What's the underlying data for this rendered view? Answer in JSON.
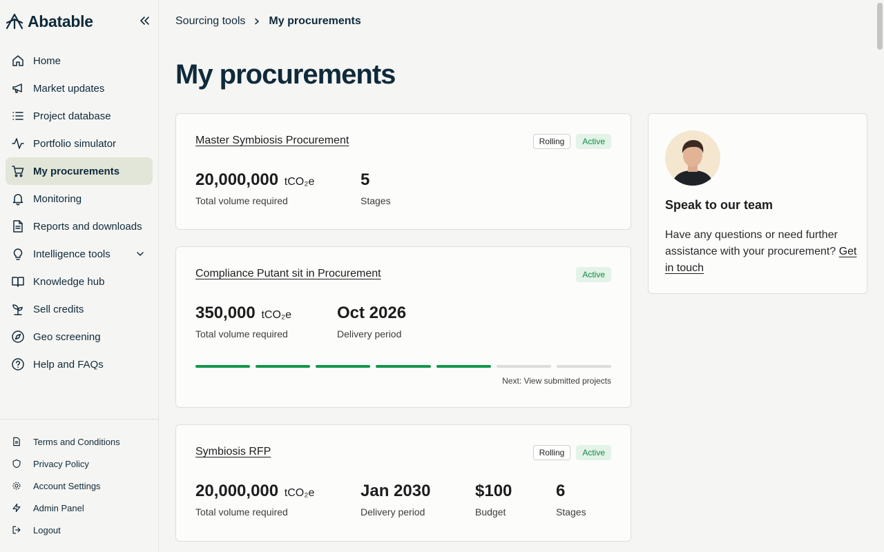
{
  "brand": {
    "name": "Abatable"
  },
  "sidebar": {
    "items": [
      {
        "label": "Home",
        "icon": "home-icon"
      },
      {
        "label": "Market updates",
        "icon": "megaphone-icon"
      },
      {
        "label": "Project database",
        "icon": "list-icon"
      },
      {
        "label": "Portfolio simulator",
        "icon": "activity-icon"
      },
      {
        "label": "My procurements",
        "icon": "cart-icon",
        "active": true
      },
      {
        "label": "Monitoring",
        "icon": "bell-icon"
      },
      {
        "label": "Reports and downloads",
        "icon": "document-icon"
      },
      {
        "label": "Intelligence tools",
        "icon": "lightbulb-icon",
        "expandable": true
      },
      {
        "label": "Knowledge hub",
        "icon": "book-icon"
      },
      {
        "label": "Sell credits",
        "icon": "sprout-icon"
      },
      {
        "label": "Geo screening",
        "icon": "compass-icon"
      },
      {
        "label": "Help and FAQs",
        "icon": "help-icon"
      }
    ],
    "footer": [
      {
        "label": "Terms and Conditions",
        "icon": "document-icon"
      },
      {
        "label": "Privacy Policy",
        "icon": "shield-icon"
      },
      {
        "label": "Account Settings",
        "icon": "gear-icon"
      },
      {
        "label": "Admin Panel",
        "icon": "lightning-icon"
      },
      {
        "label": "Logout",
        "icon": "logout-icon"
      }
    ]
  },
  "breadcrumb": {
    "parent": "Sourcing tools",
    "current": "My procurements"
  },
  "page": {
    "title": "My procurements"
  },
  "procurements": [
    {
      "title": "Master Symbiosis Procurement",
      "badges": [
        "Rolling",
        "Active"
      ],
      "metrics": [
        {
          "value": "20,000,000",
          "unit": "tCO₂e",
          "caption": "Total volume required"
        },
        {
          "value": "5",
          "caption": "Stages"
        }
      ]
    },
    {
      "title": "Compliance Putant sit in Procurement",
      "badges": [
        "Active"
      ],
      "metrics": [
        {
          "value": "350,000",
          "unit": "tCO₂e",
          "caption": "Total volume required"
        },
        {
          "value": "Oct 2026",
          "caption": "Delivery period"
        }
      ],
      "progress": {
        "completed": 5,
        "total": 7
      },
      "next": "Next: View submitted projects"
    },
    {
      "title": "Symbiosis RFP",
      "badges": [
        "Rolling",
        "Active"
      ],
      "metrics": [
        {
          "value": "20,000,000",
          "unit": "tCO₂e",
          "caption": "Total volume required"
        },
        {
          "value": "Jan 2030",
          "caption": "Delivery period"
        },
        {
          "value": "$100",
          "caption": "Budget"
        },
        {
          "value": "6",
          "caption": "Stages"
        }
      ]
    }
  ],
  "team": {
    "title": "Speak to our team",
    "text": "Have any questions or need further assistance with your procurement?",
    "link": "Get in touch"
  },
  "colors": {
    "primary": "#0f2a3a",
    "active_green": "#10974a",
    "badge_bg": "#e3f3e8",
    "nav_active": "#e2e6d9"
  }
}
